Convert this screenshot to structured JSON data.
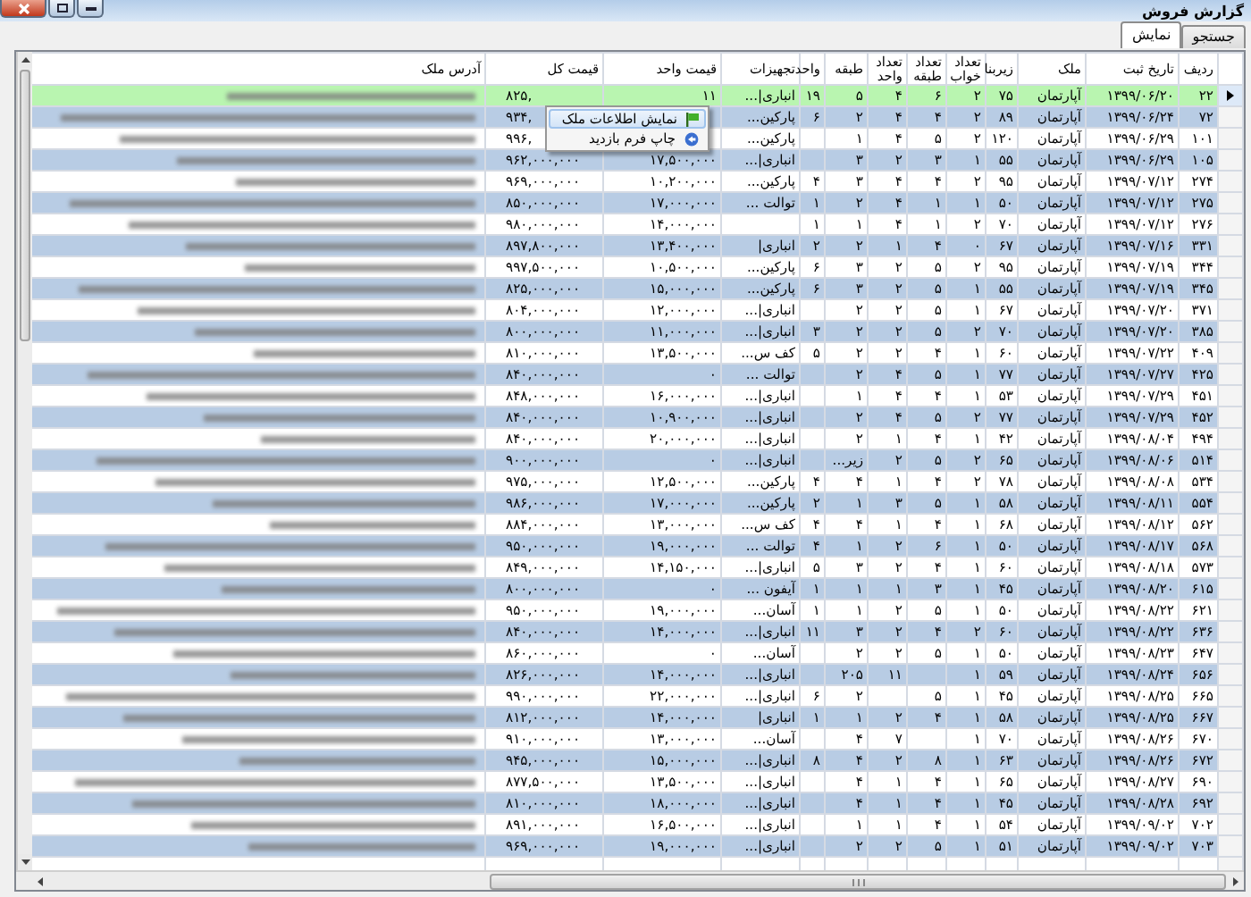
{
  "window": {
    "title": "گزارش فروش"
  },
  "tabs": [
    {
      "label": "جستجو",
      "selected": false
    },
    {
      "label": "نمایش",
      "selected": true
    }
  ],
  "table": {
    "columns": [
      "ردیف",
      "تاریخ ثبت",
      "ملک",
      "زیربنا",
      "تعداد خواب",
      "تعداد طبقه",
      "تعداد واحد",
      "طبقه",
      "واحد",
      "تجهیزات",
      "قیمت واحد",
      "قیمت کل",
      "آدرس ملک"
    ],
    "rows": [
      {
        "selected": true,
        "cells": [
          "۲۲",
          "۱۳۹۹/۰۶/۲۰",
          "آپارتمان",
          "۷۵",
          "۲",
          "۶",
          "۴",
          "۵",
          "۱۹",
          "انباری|...",
          "۱۱",
          "۸۲۵,"
        ]
      },
      {
        "selected": false,
        "cells": [
          "۷۲",
          "۱۳۹۹/۰۶/۲۴",
          "آپارتمان",
          "۸۹",
          "۲",
          "۴",
          "۴",
          "۲",
          "۶",
          "پارکین...",
          null,
          "۹۳۴,"
        ]
      },
      {
        "selected": false,
        "cells": [
          "۱۰۱",
          "۱۳۹۹/۰۶/۲۹",
          "آپارتمان",
          "۱۲۰",
          "۲",
          "۵",
          "۴",
          "۱",
          null,
          "پارکین...",
          null,
          "۹۹۶,"
        ]
      },
      {
        "selected": false,
        "cells": [
          "۱۰۵",
          "۱۳۹۹/۰۶/۲۹",
          "آپارتمان",
          "۵۵",
          "۱",
          "۳",
          "۲",
          "۳",
          null,
          "انباری|...",
          "۱۷,۵۰۰,۰۰۰",
          "۹۶۲,۰۰۰,۰۰۰"
        ]
      },
      {
        "selected": false,
        "cells": [
          "۲۷۴",
          "۱۳۹۹/۰۷/۱۲",
          "آپارتمان",
          "۹۵",
          "۲",
          "۴",
          "۴",
          "۳",
          "۴",
          "پارکین...",
          "۱۰,۲۰۰,۰۰۰",
          "۹۶۹,۰۰۰,۰۰۰"
        ]
      },
      {
        "selected": false,
        "cells": [
          "۲۷۵",
          "۱۳۹۹/۰۷/۱۲",
          "آپارتمان",
          "۵۰",
          "۱",
          "۱",
          "۴",
          "۲",
          "۱",
          "توالت ...",
          "۱۷,۰۰۰,۰۰۰",
          "۸۵۰,۰۰۰,۰۰۰"
        ]
      },
      {
        "selected": false,
        "cells": [
          "۲۷۶",
          "۱۳۹۹/۰۷/۱۲",
          "آپارتمان",
          "۷۰",
          "۲",
          "۱",
          "۴",
          "۱",
          "۱",
          null,
          "۱۴,۰۰۰,۰۰۰",
          "۹۸۰,۰۰۰,۰۰۰"
        ]
      },
      {
        "selected": false,
        "cells": [
          "۳۳۱",
          "۱۳۹۹/۰۷/۱۶",
          "آپارتمان",
          "۶۷",
          "۰",
          "۴",
          "۱",
          "۲",
          "۲",
          "انباری|",
          "۱۳,۴۰۰,۰۰۰",
          "۸۹۷,۸۰۰,۰۰۰"
        ]
      },
      {
        "selected": false,
        "cells": [
          "۳۴۴",
          "۱۳۹۹/۰۷/۱۹",
          "آپارتمان",
          "۹۵",
          "۲",
          "۵",
          "۲",
          "۳",
          "۶",
          "پارکین...",
          "۱۰,۵۰۰,۰۰۰",
          "۹۹۷,۵۰۰,۰۰۰"
        ]
      },
      {
        "selected": false,
        "cells": [
          "۳۴۵",
          "۱۳۹۹/۰۷/۱۹",
          "آپارتمان",
          "۵۵",
          "۱",
          "۵",
          "۲",
          "۳",
          "۶",
          "پارکین...",
          "۱۵,۰۰۰,۰۰۰",
          "۸۲۵,۰۰۰,۰۰۰"
        ]
      },
      {
        "selected": false,
        "cells": [
          "۳۷۱",
          "۱۳۹۹/۰۷/۲۰",
          "آپارتمان",
          "۶۷",
          "۱",
          "۵",
          "۲",
          "۲",
          null,
          "انباری|...",
          "۱۲,۰۰۰,۰۰۰",
          "۸۰۴,۰۰۰,۰۰۰"
        ]
      },
      {
        "selected": false,
        "cells": [
          "۳۸۵",
          "۱۳۹۹/۰۷/۲۰",
          "آپارتمان",
          "۷۰",
          "۲",
          "۵",
          "۲",
          "۲",
          "۳",
          "انباری|...",
          "۱۱,۰۰۰,۰۰۰",
          "۸۰۰,۰۰۰,۰۰۰"
        ]
      },
      {
        "selected": false,
        "cells": [
          "۴۰۹",
          "۱۳۹۹/۰۷/۲۲",
          "آپارتمان",
          "۶۰",
          "۱",
          "۴",
          "۲",
          "۲",
          "۵",
          "کف س...",
          "۱۳,۵۰۰,۰۰۰",
          "۸۱۰,۰۰۰,۰۰۰"
        ]
      },
      {
        "selected": false,
        "cells": [
          "۴۲۵",
          "۱۳۹۹/۰۷/۲۷",
          "آپارتمان",
          "۷۷",
          "۱",
          "۵",
          "۴",
          "۲",
          null,
          "توالت ...",
          "۰",
          "۸۴۰,۰۰۰,۰۰۰"
        ]
      },
      {
        "selected": false,
        "cells": [
          "۴۵۱",
          "۱۳۹۹/۰۷/۲۹",
          "آپارتمان",
          "۵۳",
          "۱",
          "۴",
          "۴",
          "۱",
          null,
          "انباری|...",
          "۱۶,۰۰۰,۰۰۰",
          "۸۴۸,۰۰۰,۰۰۰"
        ]
      },
      {
        "selected": false,
        "cells": [
          "۴۵۲",
          "۱۳۹۹/۰۷/۲۹",
          "آپارتمان",
          "۷۷",
          "۲",
          "۵",
          "۴",
          "۲",
          null,
          "انباری|...",
          "۱۰,۹۰۰,۰۰۰",
          "۸۴۰,۰۰۰,۰۰۰"
        ]
      },
      {
        "selected": false,
        "cells": [
          "۴۹۴",
          "۱۳۹۹/۰۸/۰۴",
          "آپارتمان",
          "۴۲",
          "۱",
          "۴",
          "۱",
          "۲",
          null,
          "انباری|...",
          "۲۰,۰۰۰,۰۰۰",
          "۸۴۰,۰۰۰,۰۰۰"
        ]
      },
      {
        "selected": false,
        "cells": [
          "۵۱۴",
          "۱۳۹۹/۰۸/۰۶",
          "آپارتمان",
          "۶۵",
          "۲",
          "۵",
          "۲",
          "زیر...",
          null,
          "انباری|...",
          "۰",
          "۹۰۰,۰۰۰,۰۰۰"
        ]
      },
      {
        "selected": false,
        "cells": [
          "۵۳۴",
          "۱۳۹۹/۰۸/۰۸",
          "آپارتمان",
          "۷۸",
          "۲",
          "۴",
          "۱",
          "۴",
          "۴",
          "پارکین...",
          "۱۲,۵۰۰,۰۰۰",
          "۹۷۵,۰۰۰,۰۰۰"
        ]
      },
      {
        "selected": false,
        "cells": [
          "۵۵۴",
          "۱۳۹۹/۰۸/۱۱",
          "آپارتمان",
          "۵۸",
          "۱",
          "۵",
          "۳",
          "۱",
          "۲",
          "پارکین...",
          "۱۷,۰۰۰,۰۰۰",
          "۹۸۶,۰۰۰,۰۰۰"
        ]
      },
      {
        "selected": false,
        "cells": [
          "۵۶۲",
          "۱۳۹۹/۰۸/۱۲",
          "آپارتمان",
          "۶۸",
          "۱",
          "۴",
          "۱",
          "۴",
          "۴",
          "کف س...",
          "۱۳,۰۰۰,۰۰۰",
          "۸۸۴,۰۰۰,۰۰۰"
        ]
      },
      {
        "selected": false,
        "cells": [
          "۵۶۸",
          "۱۳۹۹/۰۸/۱۷",
          "آپارتمان",
          "۵۰",
          "۱",
          "۶",
          "۲",
          "۱",
          "۴",
          "توالت ...",
          "۱۹,۰۰۰,۰۰۰",
          "۹۵۰,۰۰۰,۰۰۰"
        ]
      },
      {
        "selected": false,
        "cells": [
          "۵۷۳",
          "۱۳۹۹/۰۸/۱۸",
          "آپارتمان",
          "۶۰",
          "۱",
          "۴",
          "۲",
          "۳",
          "۵",
          "انباری|...",
          "۱۴,۱۵۰,۰۰۰",
          "۸۴۹,۰۰۰,۰۰۰"
        ]
      },
      {
        "selected": false,
        "cells": [
          "۶۱۵",
          "۱۳۹۹/۰۸/۲۰",
          "آپارتمان",
          "۴۵",
          "۱",
          "۳",
          "۱",
          "۱",
          "۱",
          "آیفون ...",
          "۰",
          "۸۰۰,۰۰۰,۰۰۰"
        ]
      },
      {
        "selected": false,
        "cells": [
          "۶۲۱",
          "۱۳۹۹/۰۸/۲۲",
          "آپارتمان",
          "۵۰",
          "۱",
          "۵",
          "۲",
          "۱",
          "۱",
          "آسان...",
          "۱۹,۰۰۰,۰۰۰",
          "۹۵۰,۰۰۰,۰۰۰"
        ]
      },
      {
        "selected": false,
        "cells": [
          "۶۳۶",
          "۱۳۹۹/۰۸/۲۲",
          "آپارتمان",
          "۶۰",
          "۲",
          "۴",
          "۲",
          "۳",
          "۱۱",
          "انباری|...",
          "۱۴,۰۰۰,۰۰۰",
          "۸۴۰,۰۰۰,۰۰۰"
        ]
      },
      {
        "selected": false,
        "cells": [
          "۶۴۷",
          "۱۳۹۹/۰۸/۲۳",
          "آپارتمان",
          "۵۰",
          "۱",
          "۵",
          "۲",
          "۲",
          null,
          "آسان...",
          "۰",
          "۸۶۰,۰۰۰,۰۰۰"
        ]
      },
      {
        "selected": false,
        "cells": [
          "۶۵۶",
          "۱۳۹۹/۰۸/۲۴",
          "آپارتمان",
          "۵۹",
          "۱",
          null,
          "۱۱",
          "۲۰۵",
          null,
          "انباری|...",
          "۱۴,۰۰۰,۰۰۰",
          "۸۲۶,۰۰۰,۰۰۰"
        ]
      },
      {
        "selected": false,
        "cells": [
          "۶۶۵",
          "۱۳۹۹/۰۸/۲۵",
          "آپارتمان",
          "۴۵",
          "۱",
          "۵",
          null,
          "۲",
          "۶",
          "انباری|...",
          "۲۲,۰۰۰,۰۰۰",
          "۹۹۰,۰۰۰,۰۰۰"
        ]
      },
      {
        "selected": false,
        "cells": [
          "۶۶۷",
          "۱۳۹۹/۰۸/۲۵",
          "آپارتمان",
          "۵۸",
          "۱",
          "۴",
          "۲",
          "۱",
          "۱",
          "انباری|",
          "۱۴,۰۰۰,۰۰۰",
          "۸۱۲,۰۰۰,۰۰۰"
        ]
      },
      {
        "selected": false,
        "cells": [
          "۶۷۰",
          "۱۳۹۹/۰۸/۲۶",
          "آپارتمان",
          "۷۰",
          "۱",
          null,
          "۷",
          "۴",
          null,
          "آسان...",
          "۱۳,۰۰۰,۰۰۰",
          "۹۱۰,۰۰۰,۰۰۰"
        ]
      },
      {
        "selected": false,
        "cells": [
          "۶۷۲",
          "۱۳۹۹/۰۸/۲۶",
          "آپارتمان",
          "۶۳",
          "۱",
          "۸",
          "۲",
          "۴",
          "۸",
          "انباری|...",
          "۱۵,۰۰۰,۰۰۰",
          "۹۴۵,۰۰۰,۰۰۰"
        ]
      },
      {
        "selected": false,
        "cells": [
          "۶۹۰",
          "۱۳۹۹/۰۸/۲۷",
          "آپارتمان",
          "۶۵",
          "۱",
          "۴",
          "۱",
          "۴",
          null,
          "انباری|...",
          "۱۳,۵۰۰,۰۰۰",
          "۸۷۷,۵۰۰,۰۰۰"
        ]
      },
      {
        "selected": false,
        "cells": [
          "۶۹۲",
          "۱۳۹۹/۰۸/۲۸",
          "آپارتمان",
          "۴۵",
          "۱",
          "۴",
          "۱",
          "۴",
          null,
          "انباری|...",
          "۱۸,۰۰۰,۰۰۰",
          "۸۱۰,۰۰۰,۰۰۰"
        ]
      },
      {
        "selected": false,
        "cells": [
          "۷۰۲",
          "۱۳۹۹/۰۹/۰۲",
          "آپارتمان",
          "۵۴",
          "۱",
          "۴",
          "۱",
          "۱",
          null,
          "انباری|...",
          "۱۶,۵۰۰,۰۰۰",
          "۸۹۱,۰۰۰,۰۰۰"
        ]
      },
      {
        "selected": false,
        "cells": [
          "۷۰۳",
          "۱۳۹۹/۰۹/۰۲",
          "آپارتمان",
          "۵۱",
          "۱",
          "۵",
          "۲",
          "۲",
          null,
          "انباری|...",
          "۱۹,۰۰۰,۰۰۰",
          "۹۶۹,۰۰۰,۰۰۰"
        ]
      }
    ]
  },
  "context_menu": {
    "items": [
      {
        "label": "نمایش اطلاعات ملک",
        "selected": true
      },
      {
        "label": "چاپ فرم بازدید",
        "selected": false
      }
    ]
  }
}
